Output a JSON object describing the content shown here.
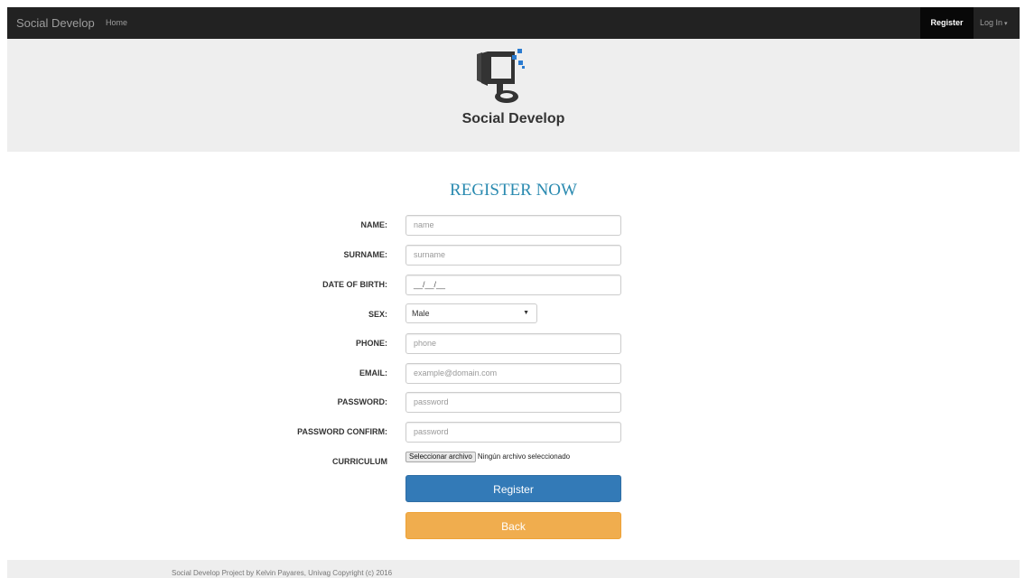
{
  "navbar": {
    "brand": "Social Develop",
    "home": "Home",
    "register": "Register",
    "login": "Log In"
  },
  "header": {
    "logo_text": "Social Develop",
    "logo_icon": "monitor-logo-icon"
  },
  "form": {
    "title": "REGISTER NOW",
    "fields": [
      {
        "label": "NAME:",
        "placeholder": "name"
      },
      {
        "label": "SURNAME:",
        "placeholder": "surname"
      },
      {
        "label": "DATE OF BIRTH:",
        "value": "__/__/__"
      },
      {
        "label": "SEX:",
        "value": "Male",
        "options": [
          "Male"
        ]
      },
      {
        "label": "PHONE:",
        "placeholder": "phone"
      },
      {
        "label": "EMAIL:",
        "placeholder": "example@domain.com"
      },
      {
        "label": "PASSWORD:",
        "placeholder": "password"
      },
      {
        "label": "PASSWORD CONFIRM:",
        "placeholder": "password"
      },
      {
        "label": "CURRICULUM",
        "button": "Seleccionar archivo",
        "status": "Ningún archivo seleccionado"
      }
    ],
    "register_button": "Register",
    "back_button": "Back"
  },
  "footer": {
    "text": "Social Develop Project by Kelvin Payares, Univag Copyright (c) 2016"
  },
  "colors": {
    "navbar_bg": "#222222",
    "title": "#2a8ab0",
    "primary": "#337ab7",
    "warning": "#f0ad4e"
  }
}
